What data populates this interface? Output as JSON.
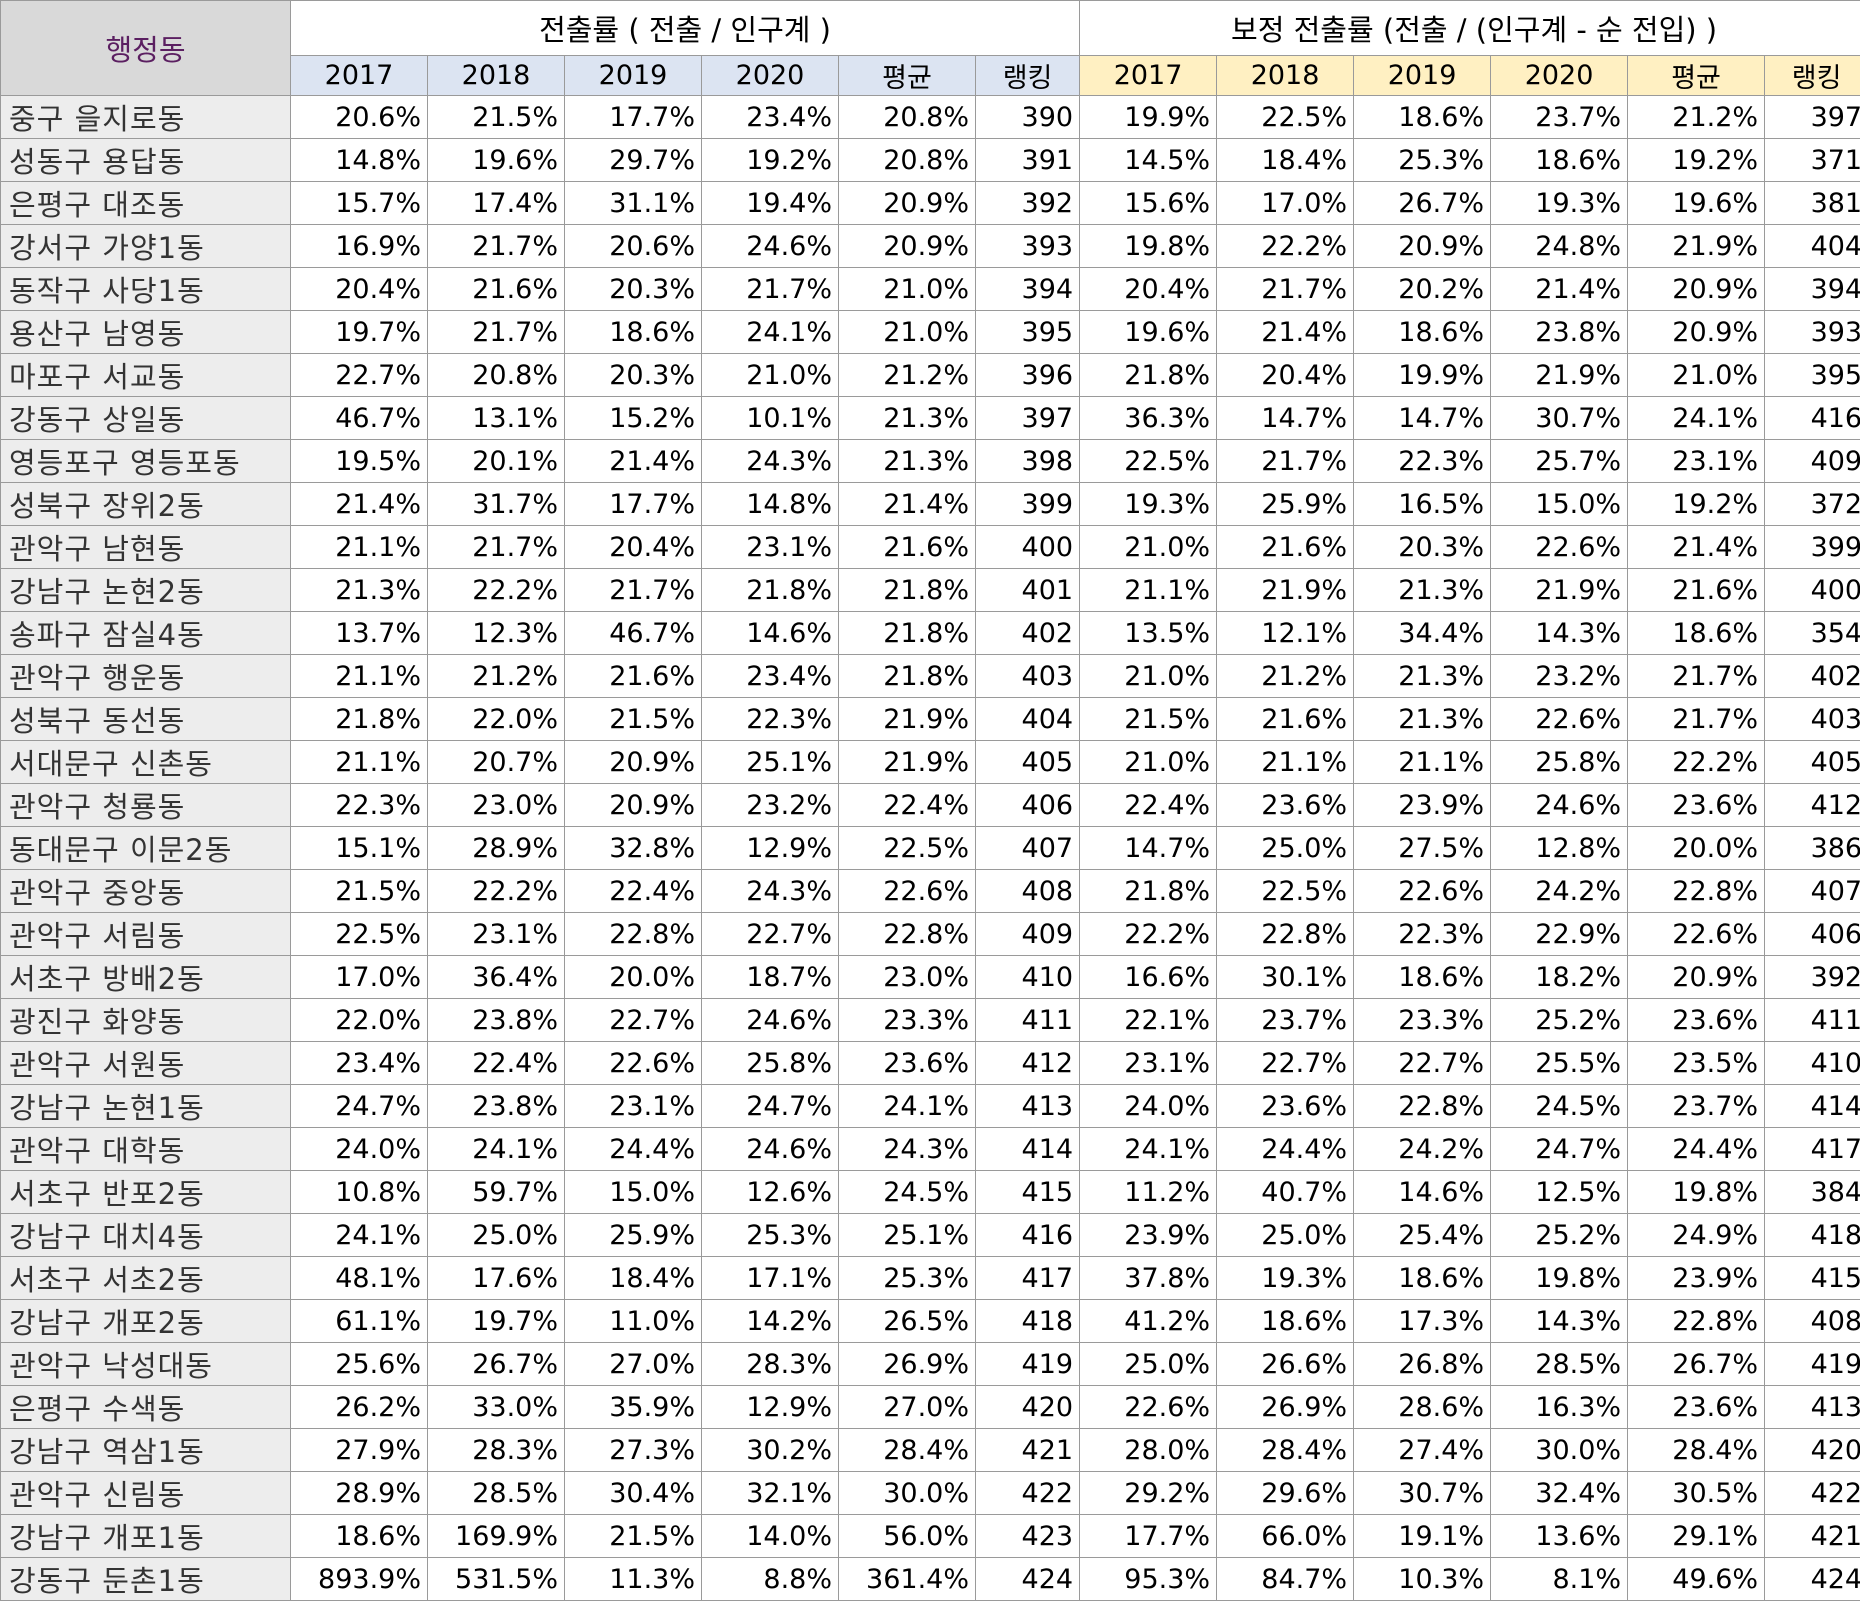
{
  "table": {
    "corner_label": "행정동",
    "group1_title": "전출률 ( 전출 / 인구계 )",
    "group2_title": "보정 전출률 (전출 / (인구계 - 순 전입) )",
    "group1_headers": [
      "2017",
      "2018",
      "2019",
      "2020",
      "평균",
      "랭킹"
    ],
    "group2_headers": [
      "2017",
      "2018",
      "2019",
      "2020",
      "평균",
      "랭킹"
    ],
    "rows": [
      [
        "중구 을지로동",
        "20.6%",
        "21.5%",
        "17.7%",
        "23.4%",
        "20.8%",
        "390",
        "19.9%",
        "22.5%",
        "18.6%",
        "23.7%",
        "21.2%",
        "397"
      ],
      [
        "성동구 용답동",
        "14.8%",
        "19.6%",
        "29.7%",
        "19.2%",
        "20.8%",
        "391",
        "14.5%",
        "18.4%",
        "25.3%",
        "18.6%",
        "19.2%",
        "371"
      ],
      [
        "은평구 대조동",
        "15.7%",
        "17.4%",
        "31.1%",
        "19.4%",
        "20.9%",
        "392",
        "15.6%",
        "17.0%",
        "26.7%",
        "19.3%",
        "19.6%",
        "381"
      ],
      [
        "강서구 가양1동",
        "16.9%",
        "21.7%",
        "20.6%",
        "24.6%",
        "20.9%",
        "393",
        "19.8%",
        "22.2%",
        "20.9%",
        "24.8%",
        "21.9%",
        "404"
      ],
      [
        "동작구 사당1동",
        "20.4%",
        "21.6%",
        "20.3%",
        "21.7%",
        "21.0%",
        "394",
        "20.4%",
        "21.7%",
        "20.2%",
        "21.4%",
        "20.9%",
        "394"
      ],
      [
        "용산구 남영동",
        "19.7%",
        "21.7%",
        "18.6%",
        "24.1%",
        "21.0%",
        "395",
        "19.6%",
        "21.4%",
        "18.6%",
        "23.8%",
        "20.9%",
        "393"
      ],
      [
        "마포구 서교동",
        "22.7%",
        "20.8%",
        "20.3%",
        "21.0%",
        "21.2%",
        "396",
        "21.8%",
        "20.4%",
        "19.9%",
        "21.9%",
        "21.0%",
        "395"
      ],
      [
        "강동구 상일동",
        "46.7%",
        "13.1%",
        "15.2%",
        "10.1%",
        "21.3%",
        "397",
        "36.3%",
        "14.7%",
        "14.7%",
        "30.7%",
        "24.1%",
        "416"
      ],
      [
        "영등포구 영등포동",
        "19.5%",
        "20.1%",
        "21.4%",
        "24.3%",
        "21.3%",
        "398",
        "22.5%",
        "21.7%",
        "22.3%",
        "25.7%",
        "23.1%",
        "409"
      ],
      [
        "성북구 장위2동",
        "21.4%",
        "31.7%",
        "17.7%",
        "14.8%",
        "21.4%",
        "399",
        "19.3%",
        "25.9%",
        "16.5%",
        "15.0%",
        "19.2%",
        "372"
      ],
      [
        "관악구 남현동",
        "21.1%",
        "21.7%",
        "20.4%",
        "23.1%",
        "21.6%",
        "400",
        "21.0%",
        "21.6%",
        "20.3%",
        "22.6%",
        "21.4%",
        "399"
      ],
      [
        "강남구 논현2동",
        "21.3%",
        "22.2%",
        "21.7%",
        "21.8%",
        "21.8%",
        "401",
        "21.1%",
        "21.9%",
        "21.3%",
        "21.9%",
        "21.6%",
        "400"
      ],
      [
        "송파구 잠실4동",
        "13.7%",
        "12.3%",
        "46.7%",
        "14.6%",
        "21.8%",
        "402",
        "13.5%",
        "12.1%",
        "34.4%",
        "14.3%",
        "18.6%",
        "354"
      ],
      [
        "관악구 행운동",
        "21.1%",
        "21.2%",
        "21.6%",
        "23.4%",
        "21.8%",
        "403",
        "21.0%",
        "21.2%",
        "21.3%",
        "23.2%",
        "21.7%",
        "402"
      ],
      [
        "성북구 동선동",
        "21.8%",
        "22.0%",
        "21.5%",
        "22.3%",
        "21.9%",
        "404",
        "21.5%",
        "21.6%",
        "21.3%",
        "22.6%",
        "21.7%",
        "403"
      ],
      [
        "서대문구 신촌동",
        "21.1%",
        "20.7%",
        "20.9%",
        "25.1%",
        "21.9%",
        "405",
        "21.0%",
        "21.1%",
        "21.1%",
        "25.8%",
        "22.2%",
        "405"
      ],
      [
        "관악구 청룡동",
        "22.3%",
        "23.0%",
        "20.9%",
        "23.2%",
        "22.4%",
        "406",
        "22.4%",
        "23.6%",
        "23.9%",
        "24.6%",
        "23.6%",
        "412"
      ],
      [
        "동대문구 이문2동",
        "15.1%",
        "28.9%",
        "32.8%",
        "12.9%",
        "22.5%",
        "407",
        "14.7%",
        "25.0%",
        "27.5%",
        "12.8%",
        "20.0%",
        "386"
      ],
      [
        "관악구 중앙동",
        "21.5%",
        "22.2%",
        "22.4%",
        "24.3%",
        "22.6%",
        "408",
        "21.8%",
        "22.5%",
        "22.6%",
        "24.2%",
        "22.8%",
        "407"
      ],
      [
        "관악구 서림동",
        "22.5%",
        "23.1%",
        "22.8%",
        "22.7%",
        "22.8%",
        "409",
        "22.2%",
        "22.8%",
        "22.3%",
        "22.9%",
        "22.6%",
        "406"
      ],
      [
        "서초구 방배2동",
        "17.0%",
        "36.4%",
        "20.0%",
        "18.7%",
        "23.0%",
        "410",
        "16.6%",
        "30.1%",
        "18.6%",
        "18.2%",
        "20.9%",
        "392"
      ],
      [
        "광진구 화양동",
        "22.0%",
        "23.8%",
        "22.7%",
        "24.6%",
        "23.3%",
        "411",
        "22.1%",
        "23.7%",
        "23.3%",
        "25.2%",
        "23.6%",
        "411"
      ],
      [
        "관악구 서원동",
        "23.4%",
        "22.4%",
        "22.6%",
        "25.8%",
        "23.6%",
        "412",
        "23.1%",
        "22.7%",
        "22.7%",
        "25.5%",
        "23.5%",
        "410"
      ],
      [
        "강남구 논현1동",
        "24.7%",
        "23.8%",
        "23.1%",
        "24.7%",
        "24.1%",
        "413",
        "24.0%",
        "23.6%",
        "22.8%",
        "24.5%",
        "23.7%",
        "414"
      ],
      [
        "관악구 대학동",
        "24.0%",
        "24.1%",
        "24.4%",
        "24.6%",
        "24.3%",
        "414",
        "24.1%",
        "24.4%",
        "24.2%",
        "24.7%",
        "24.4%",
        "417"
      ],
      [
        "서초구 반포2동",
        "10.8%",
        "59.7%",
        "15.0%",
        "12.6%",
        "24.5%",
        "415",
        "11.2%",
        "40.7%",
        "14.6%",
        "12.5%",
        "19.8%",
        "384"
      ],
      [
        "강남구 대치4동",
        "24.1%",
        "25.0%",
        "25.9%",
        "25.3%",
        "25.1%",
        "416",
        "23.9%",
        "25.0%",
        "25.4%",
        "25.2%",
        "24.9%",
        "418"
      ],
      [
        "서초구 서초2동",
        "48.1%",
        "17.6%",
        "18.4%",
        "17.1%",
        "25.3%",
        "417",
        "37.8%",
        "19.3%",
        "18.6%",
        "19.8%",
        "23.9%",
        "415"
      ],
      [
        "강남구 개포2동",
        "61.1%",
        "19.7%",
        "11.0%",
        "14.2%",
        "26.5%",
        "418",
        "41.2%",
        "18.6%",
        "17.3%",
        "14.3%",
        "22.8%",
        "408"
      ],
      [
        "관악구 낙성대동",
        "25.6%",
        "26.7%",
        "27.0%",
        "28.3%",
        "26.9%",
        "419",
        "25.0%",
        "26.6%",
        "26.8%",
        "28.5%",
        "26.7%",
        "419"
      ],
      [
        "은평구 수색동",
        "26.2%",
        "33.0%",
        "35.9%",
        "12.9%",
        "27.0%",
        "420",
        "22.6%",
        "26.9%",
        "28.6%",
        "16.3%",
        "23.6%",
        "413"
      ],
      [
        "강남구 역삼1동",
        "27.9%",
        "28.3%",
        "27.3%",
        "30.2%",
        "28.4%",
        "421",
        "28.0%",
        "28.4%",
        "27.4%",
        "30.0%",
        "28.4%",
        "420"
      ],
      [
        "관악구 신림동",
        "28.9%",
        "28.5%",
        "30.4%",
        "32.1%",
        "30.0%",
        "422",
        "29.2%",
        "29.6%",
        "30.7%",
        "32.4%",
        "30.5%",
        "422"
      ],
      [
        "강남구 개포1동",
        "18.6%",
        "169.9%",
        "21.5%",
        "14.0%",
        "56.0%",
        "423",
        "17.7%",
        "66.0%",
        "19.1%",
        "13.6%",
        "29.1%",
        "421"
      ],
      [
        "강동구 둔촌1동",
        "893.9%",
        "531.5%",
        "11.3%",
        "8.8%",
        "361.4%",
        "424",
        "95.3%",
        "84.7%",
        "10.3%",
        "8.1%",
        "49.6%",
        "424"
      ]
    ]
  }
}
